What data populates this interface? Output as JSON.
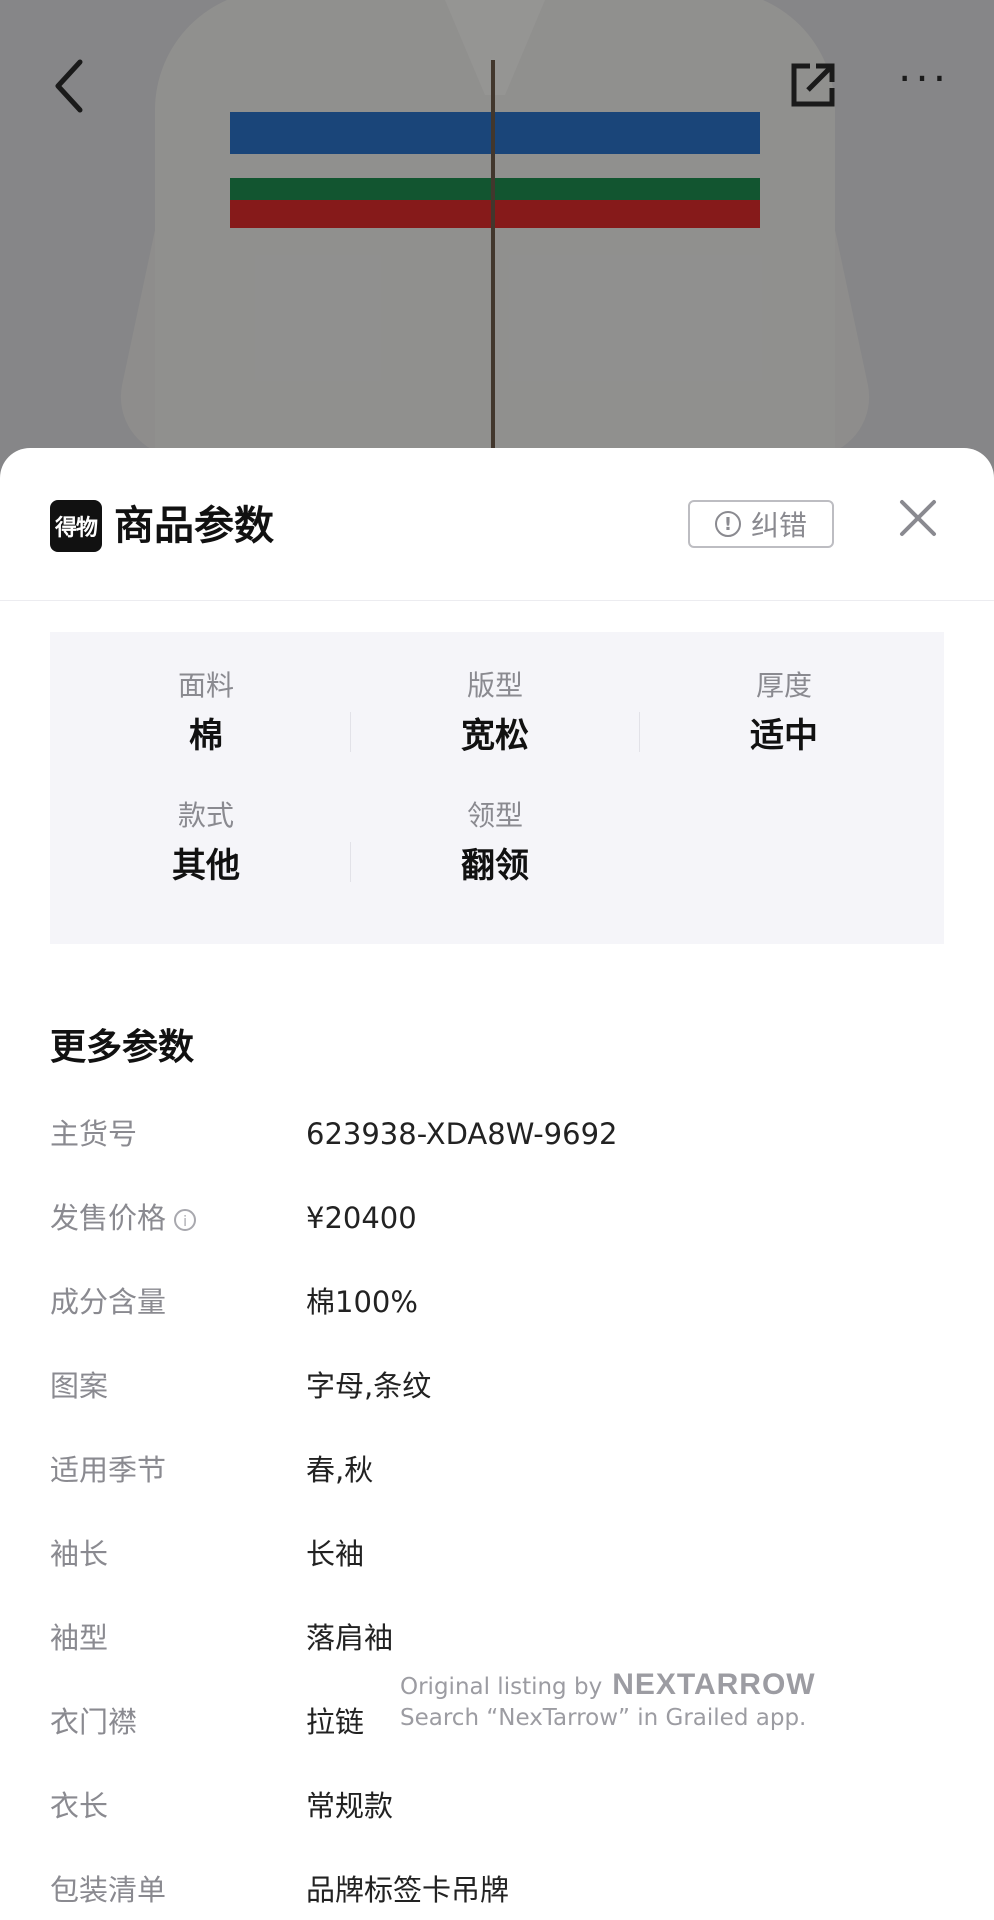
{
  "header": {
    "back_icon": "chevron-left-icon",
    "share_icon": "external-link-icon",
    "more_icon": "ellipsis-icon",
    "more_label": "···"
  },
  "sheet": {
    "logo_text": "得物",
    "title": "商品参数",
    "report_label": "纠错",
    "report_icon": "exclamation-circle-icon",
    "close_icon": "close-icon"
  },
  "specs": [
    {
      "label": "面料",
      "value": "棉"
    },
    {
      "label": "版型",
      "value": "宽松"
    },
    {
      "label": "厚度",
      "value": "适中"
    },
    {
      "label": "款式",
      "value": "其他"
    },
    {
      "label": "领型",
      "value": "翻领"
    }
  ],
  "more_params": {
    "title": "更多参数",
    "rows": [
      {
        "label": "主货号",
        "value": "623938-XDA8W-9692"
      },
      {
        "label": "发售价格",
        "value": "¥20400"
      },
      {
        "label": "成分含量",
        "value": "棉100%"
      },
      {
        "label": "图案",
        "value": "字母,条纹"
      },
      {
        "label": "适用季节",
        "value": "春,秋"
      },
      {
        "label": "袖长",
        "value": "长袖"
      },
      {
        "label": "袖型",
        "value": "落肩袖"
      },
      {
        "label": "衣门襟",
        "value": "拉链"
      },
      {
        "label": "衣长",
        "value": "常规款"
      },
      {
        "label": "包装清单",
        "value": "品牌标签卡吊牌"
      }
    ]
  },
  "watermark": {
    "line1": "Original listing by",
    "brand": "NEXTARROW",
    "line2": "Search “NexTarrow” in Grailed app."
  }
}
